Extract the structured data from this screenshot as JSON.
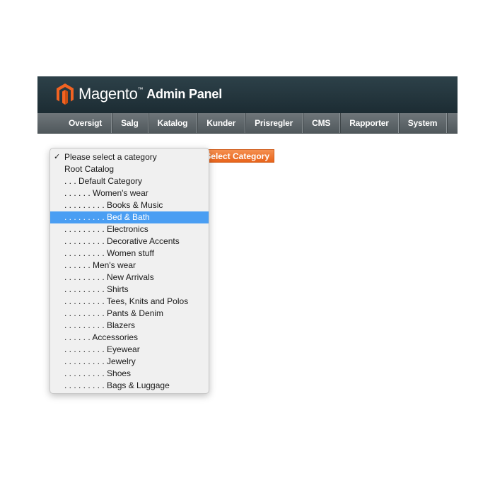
{
  "header": {
    "logo_name": "Magento",
    "logo_tm": "™",
    "logo_subtitle": "Admin Panel",
    "logo_icon": "magento-logo-icon",
    "background": "#24363d"
  },
  "nav": {
    "items": [
      "Oversigt",
      "Salg",
      "Katalog",
      "Kunder",
      "Prisregler",
      "CMS",
      "Rapporter",
      "System"
    ]
  },
  "select_button": {
    "label": "Select Category",
    "color": "#f18b3c"
  },
  "dropdown": {
    "check_glyph": "✓",
    "selected_highlight_color": "#4a9ef3",
    "options": [
      {
        "label": "Please select a category",
        "checked": true,
        "highlighted": false
      },
      {
        "label": "Root Catalog",
        "checked": false,
        "highlighted": false
      },
      {
        "label": ". . . Default Category",
        "checked": false,
        "highlighted": false
      },
      {
        "label": ". . . . . . Women's wear",
        "checked": false,
        "highlighted": false
      },
      {
        "label": ". . . . . . . . . Books & Music",
        "checked": false,
        "highlighted": false
      },
      {
        "label": ". . . . . . . . . Bed & Bath",
        "checked": false,
        "highlighted": true
      },
      {
        "label": ". . . . . . . . . Electronics",
        "checked": false,
        "highlighted": false
      },
      {
        "label": ". . . . . . . . . Decorative Accents",
        "checked": false,
        "highlighted": false
      },
      {
        "label": ". . . . . . . . . Women stuff",
        "checked": false,
        "highlighted": false
      },
      {
        "label": ". . . . . . Men's wear",
        "checked": false,
        "highlighted": false
      },
      {
        "label": ". . . . . . . . . New Arrivals",
        "checked": false,
        "highlighted": false
      },
      {
        "label": ". . . . . . . . . Shirts",
        "checked": false,
        "highlighted": false
      },
      {
        "label": ". . . . . . . . . Tees, Knits and Polos",
        "checked": false,
        "highlighted": false
      },
      {
        "label": ". . . . . . . . . Pants & Denim",
        "checked": false,
        "highlighted": false
      },
      {
        "label": ". . . . . . . . . Blazers",
        "checked": false,
        "highlighted": false
      },
      {
        "label": ". . . . . . Accessories",
        "checked": false,
        "highlighted": false
      },
      {
        "label": ". . . . . . . . . Eyewear",
        "checked": false,
        "highlighted": false
      },
      {
        "label": ". . . . . . . . . Jewelry",
        "checked": false,
        "highlighted": false
      },
      {
        "label": ". . . . . . . . . Shoes",
        "checked": false,
        "highlighted": false
      },
      {
        "label": ". . . . . . . . . Bags & Luggage",
        "checked": false,
        "highlighted": false
      }
    ]
  }
}
